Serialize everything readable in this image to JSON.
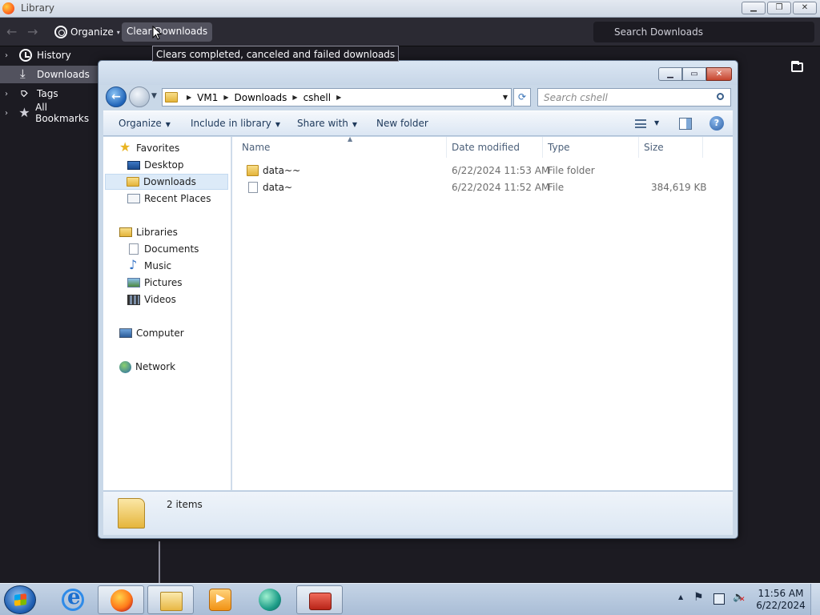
{
  "library": {
    "title": "Library",
    "toolbar": {
      "organize_label": "Organize",
      "clear_downloads_label": "Clear Downloads",
      "search_placeholder": "Search Downloads"
    },
    "tooltip": "Clears completed, canceled and failed downloads",
    "sidebar": [
      {
        "label": "History",
        "icon": "clock-icon",
        "expandable": true
      },
      {
        "label": "Downloads",
        "icon": "download-icon",
        "selected": true
      },
      {
        "label": "Tags",
        "icon": "tag-icon",
        "expandable": true
      },
      {
        "label": "All Bookmarks",
        "icon": "star-icon",
        "expandable": true
      }
    ]
  },
  "explorer": {
    "breadcrumb": [
      "VM1",
      "Downloads",
      "cshell"
    ],
    "search_placeholder": "Search cshell",
    "commands": {
      "organize": "Organize",
      "include_in_library": "Include in library",
      "share_with": "Share with",
      "new_folder": "New folder"
    },
    "nav": {
      "favorites": "Favorites",
      "desktop": "Desktop",
      "downloads": "Downloads",
      "recent_places": "Recent Places",
      "libraries": "Libraries",
      "documents": "Documents",
      "music": "Music",
      "pictures": "Pictures",
      "videos": "Videos",
      "computer": "Computer",
      "network": "Network"
    },
    "columns": {
      "name": "Name",
      "date_modified": "Date modified",
      "type": "Type",
      "size": "Size"
    },
    "files": [
      {
        "name": "data~~",
        "date": "6/22/2024 11:53 AM",
        "type": "File folder",
        "size": "",
        "icon": "folder-icon"
      },
      {
        "name": "data~",
        "date": "6/22/2024 11:52 AM",
        "type": "File",
        "size": "384,619 KB",
        "icon": "file-icon"
      }
    ],
    "status": "2 items"
  },
  "taskbar": {
    "apps": [
      "internet-explorer",
      "firefox",
      "windows-explorer",
      "media-player",
      "cshell",
      "toolbox"
    ],
    "time": "11:56 AM",
    "date": "6/22/2024"
  }
}
